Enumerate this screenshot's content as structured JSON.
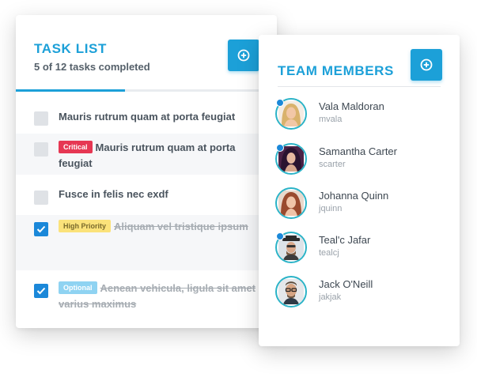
{
  "task_list": {
    "title": "TASK LIST",
    "subtitle": "5 of 12 tasks completed",
    "progress_completed": 5,
    "progress_total": 12,
    "add_icon": "plus-circle-icon",
    "tasks": [
      {
        "text": "Mauris rutrum quam at porta feugiat",
        "checked": false,
        "badge": ""
      },
      {
        "text": "Mauris rutrum quam at porta feugiat",
        "checked": false,
        "badge": "Critical"
      },
      {
        "text": "Fusce in felis nec exdf",
        "checked": false,
        "badge": ""
      },
      {
        "text": "Aliquam vel tristique ipsum",
        "checked": true,
        "badge": "High Priority"
      },
      {
        "text": "Aenean vehicula, ligula sit amet varius maximus",
        "checked": true,
        "badge": "Optional"
      }
    ]
  },
  "team_members": {
    "title": "TEAM MEMBERS",
    "add_icon": "plus-circle-icon",
    "members": [
      {
        "name": "Vala Maldoran",
        "username": "mvala",
        "online": true
      },
      {
        "name": "Samantha Carter",
        "username": "scarter",
        "online": true
      },
      {
        "name": "Johanna Quinn",
        "username": "jquinn",
        "online": false
      },
      {
        "name": "Teal'c Jafar",
        "username": "tealcj",
        "online": true
      },
      {
        "name": "Jack O'Neill",
        "username": "jakjak",
        "online": false
      }
    ]
  },
  "colors": {
    "accent": "#1ca0d8",
    "checkbox_checked": "#1b88d9",
    "critical": "#e63753",
    "high_priority": "#fbe27a",
    "optional": "#8fd3f2",
    "avatar_ring": "#2bb3c7"
  }
}
